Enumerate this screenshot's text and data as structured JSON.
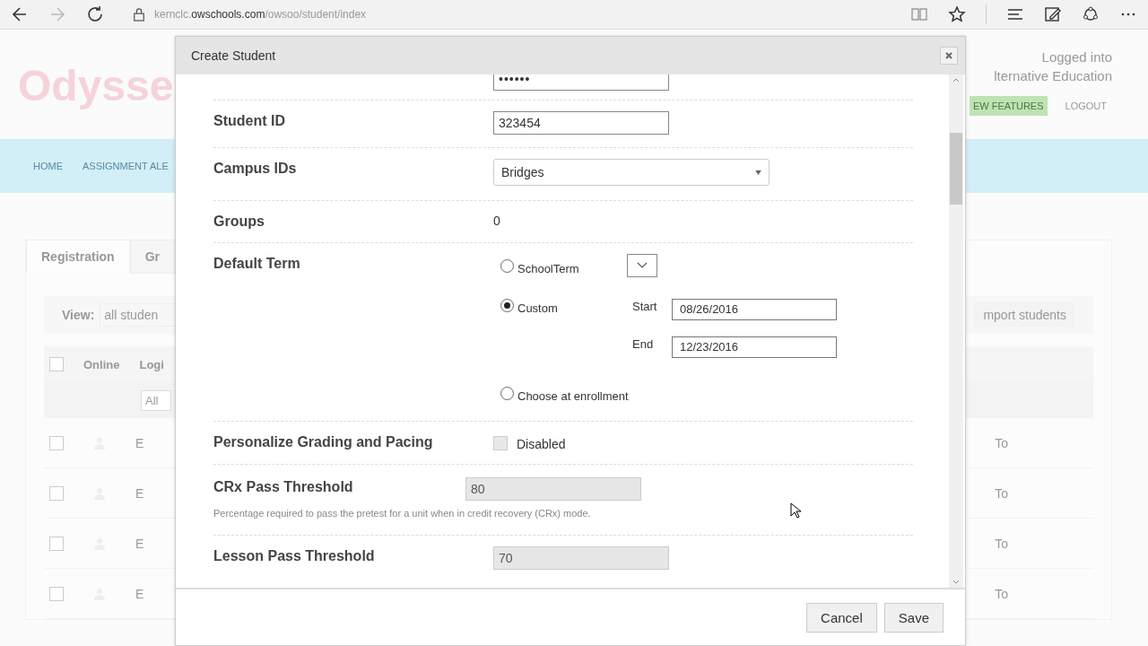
{
  "browser": {
    "url_parts": [
      {
        "text": "kernclc.",
        "strong": false
      },
      {
        "text": "owschools.com",
        "strong": true
      },
      {
        "text": "/owsoo/student/index",
        "strong": false
      }
    ]
  },
  "page": {
    "logo": "Odysse",
    "login_lines": [
      "Logged into",
      "lternative Education"
    ],
    "header_buttons": [
      {
        "label": "EW FEATURES",
        "kind": "green"
      },
      {
        "label": "LOGOUT",
        "kind": "plain"
      }
    ],
    "nav": [
      "HOME",
      "ASSIGNMENT ALE"
    ],
    "tabs": [
      {
        "label": "Registration",
        "selected": true
      },
      {
        "label": "Gr",
        "selected": false
      }
    ],
    "view_label": "View:",
    "view_value": "all studen",
    "import_button": "mport students",
    "header_checked": false,
    "columns": [
      "Online",
      "Logi"
    ],
    "filter": "All",
    "rows": [
      {
        "checked": false,
        "cell": "E",
        "action": "To"
      },
      {
        "checked": false,
        "cell": "E",
        "action": "To"
      },
      {
        "checked": false,
        "cell": "E",
        "action": "To"
      },
      {
        "checked": false,
        "cell": "E",
        "action": "To"
      }
    ]
  },
  "dialog": {
    "title": "Create Student",
    "password_dots": "••••••",
    "student_id": {
      "label": "Student ID",
      "value": "323454"
    },
    "campus": {
      "label": "Campus IDs",
      "value": "Bridges"
    },
    "groups": {
      "label": "Groups",
      "value": "0"
    },
    "default_term": {
      "label": "Default Term",
      "options": [
        {
          "kind": "schoolterm",
          "label": "SchoolTerm",
          "selected": false
        },
        {
          "kind": "custom",
          "label": "Custom",
          "selected": true,
          "start_label": "Start",
          "start": "08/26/2016",
          "end_label": "End",
          "end": "12/23/2016"
        },
        {
          "kind": "enrollment",
          "label": "Choose at enrollment",
          "selected": false
        }
      ]
    },
    "personalize": {
      "label": "Personalize Grading and Pacing",
      "checkbox_label": "Disabled",
      "checked": false
    },
    "crx": {
      "label": "CRx Pass Threshold",
      "value": "80",
      "hint": "Percentage required to pass the pretest for a unit when in credit recovery (CRx) mode."
    },
    "lesson": {
      "label": "Lesson Pass Threshold",
      "value": "70"
    },
    "buttons": [
      "Cancel",
      "Save"
    ]
  }
}
